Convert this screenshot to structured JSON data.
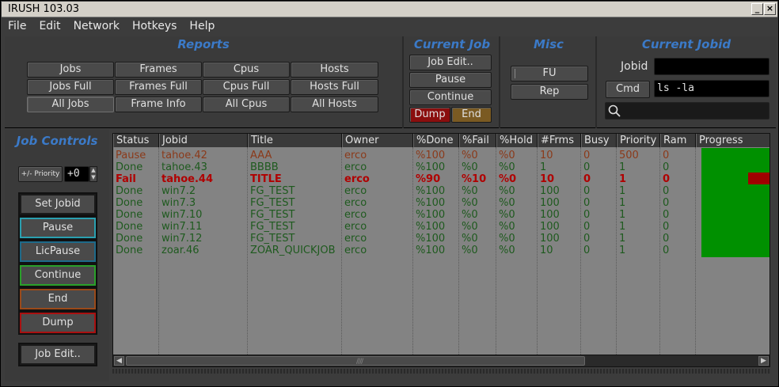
{
  "window": {
    "title": "IRUSH 103.03",
    "min_label": "_",
    "close_label": "×"
  },
  "menu": [
    "File",
    "Edit",
    "Network",
    "Hotkeys",
    "Help"
  ],
  "reports": {
    "title": "Reports",
    "buttons": [
      [
        "Jobs",
        "Frames",
        "Cpus",
        "Hosts"
      ],
      [
        "Jobs Full",
        "Frames Full",
        "Cpus Full",
        "Hosts Full"
      ],
      [
        "All Jobs",
        "Frame Info",
        "All Cpus",
        "All Hosts"
      ]
    ]
  },
  "current_job": {
    "title": "Current Job",
    "job_edit": "Job Edit..",
    "pause": "Pause",
    "continue": "Continue",
    "dump": "Dump",
    "end": "End"
  },
  "misc": {
    "title": "Misc",
    "fu": "FU",
    "rep": "Rep"
  },
  "current_jobid": {
    "title": "Current Jobid",
    "jobid_label": "Jobid",
    "jobid_value": "",
    "cmd_label": "Cmd",
    "cmd_value": "ls -la",
    "search_value": ""
  },
  "job_controls": {
    "title": "Job Controls",
    "priority_label": "+/- Priority",
    "priority_value": "+0",
    "set_jobid": "Set Jobid",
    "pause": "Pause",
    "licpause": "LicPause",
    "continue": "Continue",
    "end": "End",
    "dump": "Dump",
    "job_edit": "Job Edit.."
  },
  "table": {
    "columns": [
      "Status",
      "Jobid",
      "Title",
      "Owner",
      "%Done",
      "%Fail",
      "%Hold",
      "#Frms",
      "Busy",
      "Priority",
      "Ram",
      "Progress"
    ],
    "rows": [
      {
        "kind": "pause",
        "cells": [
          "Pause",
          "tahoe.42",
          "AAA",
          "erco",
          "%100",
          "%0",
          "%0",
          "10",
          "0",
          "500",
          "0"
        ]
      },
      {
        "kind": "done",
        "cells": [
          "Done",
          "tahoe.43",
          "BBBB",
          "erco",
          "%100",
          "%0",
          "%0",
          "1",
          "0",
          "1",
          "0"
        ]
      },
      {
        "kind": "fail",
        "cells": [
          "Fail",
          "tahoe.44",
          "TITLE",
          "erco",
          "%90",
          "%10",
          "%0",
          "10",
          "0",
          "1",
          "0"
        ]
      },
      {
        "kind": "done",
        "cells": [
          "Done",
          "win7.2",
          "FG_TEST",
          "erco",
          "%100",
          "%0",
          "%0",
          "100",
          "0",
          "1",
          "0"
        ]
      },
      {
        "kind": "done",
        "cells": [
          "Done",
          "win7.3",
          "FG_TEST",
          "erco",
          "%100",
          "%0",
          "%0",
          "100",
          "0",
          "1",
          "0"
        ]
      },
      {
        "kind": "done",
        "cells": [
          "Done",
          "win7.10",
          "FG_TEST",
          "erco",
          "%100",
          "%0",
          "%0",
          "100",
          "0",
          "1",
          "0"
        ]
      },
      {
        "kind": "done",
        "cells": [
          "Done",
          "win7.11",
          "FG_TEST",
          "erco",
          "%100",
          "%0",
          "%0",
          "100",
          "0",
          "1",
          "0"
        ]
      },
      {
        "kind": "done",
        "cells": [
          "Done",
          "win7.12",
          "FG_TEST",
          "erco",
          "%100",
          "%0",
          "%0",
          "100",
          "0",
          "1",
          "0"
        ]
      },
      {
        "kind": "done",
        "cells": [
          "Done",
          "zoar.46",
          "ZOAR_QUICKJOB",
          "erco",
          "%100",
          "%0",
          "%0",
          "10",
          "0",
          "1",
          "0"
        ]
      }
    ]
  },
  "colors": {
    "accent_title": "#3b7ac8",
    "progress_done": "#009000",
    "progress_fail": "#a00000",
    "row_done": "#1e5a1e",
    "row_pause": "#8b3a1a",
    "row_fail": "#b00000"
  }
}
